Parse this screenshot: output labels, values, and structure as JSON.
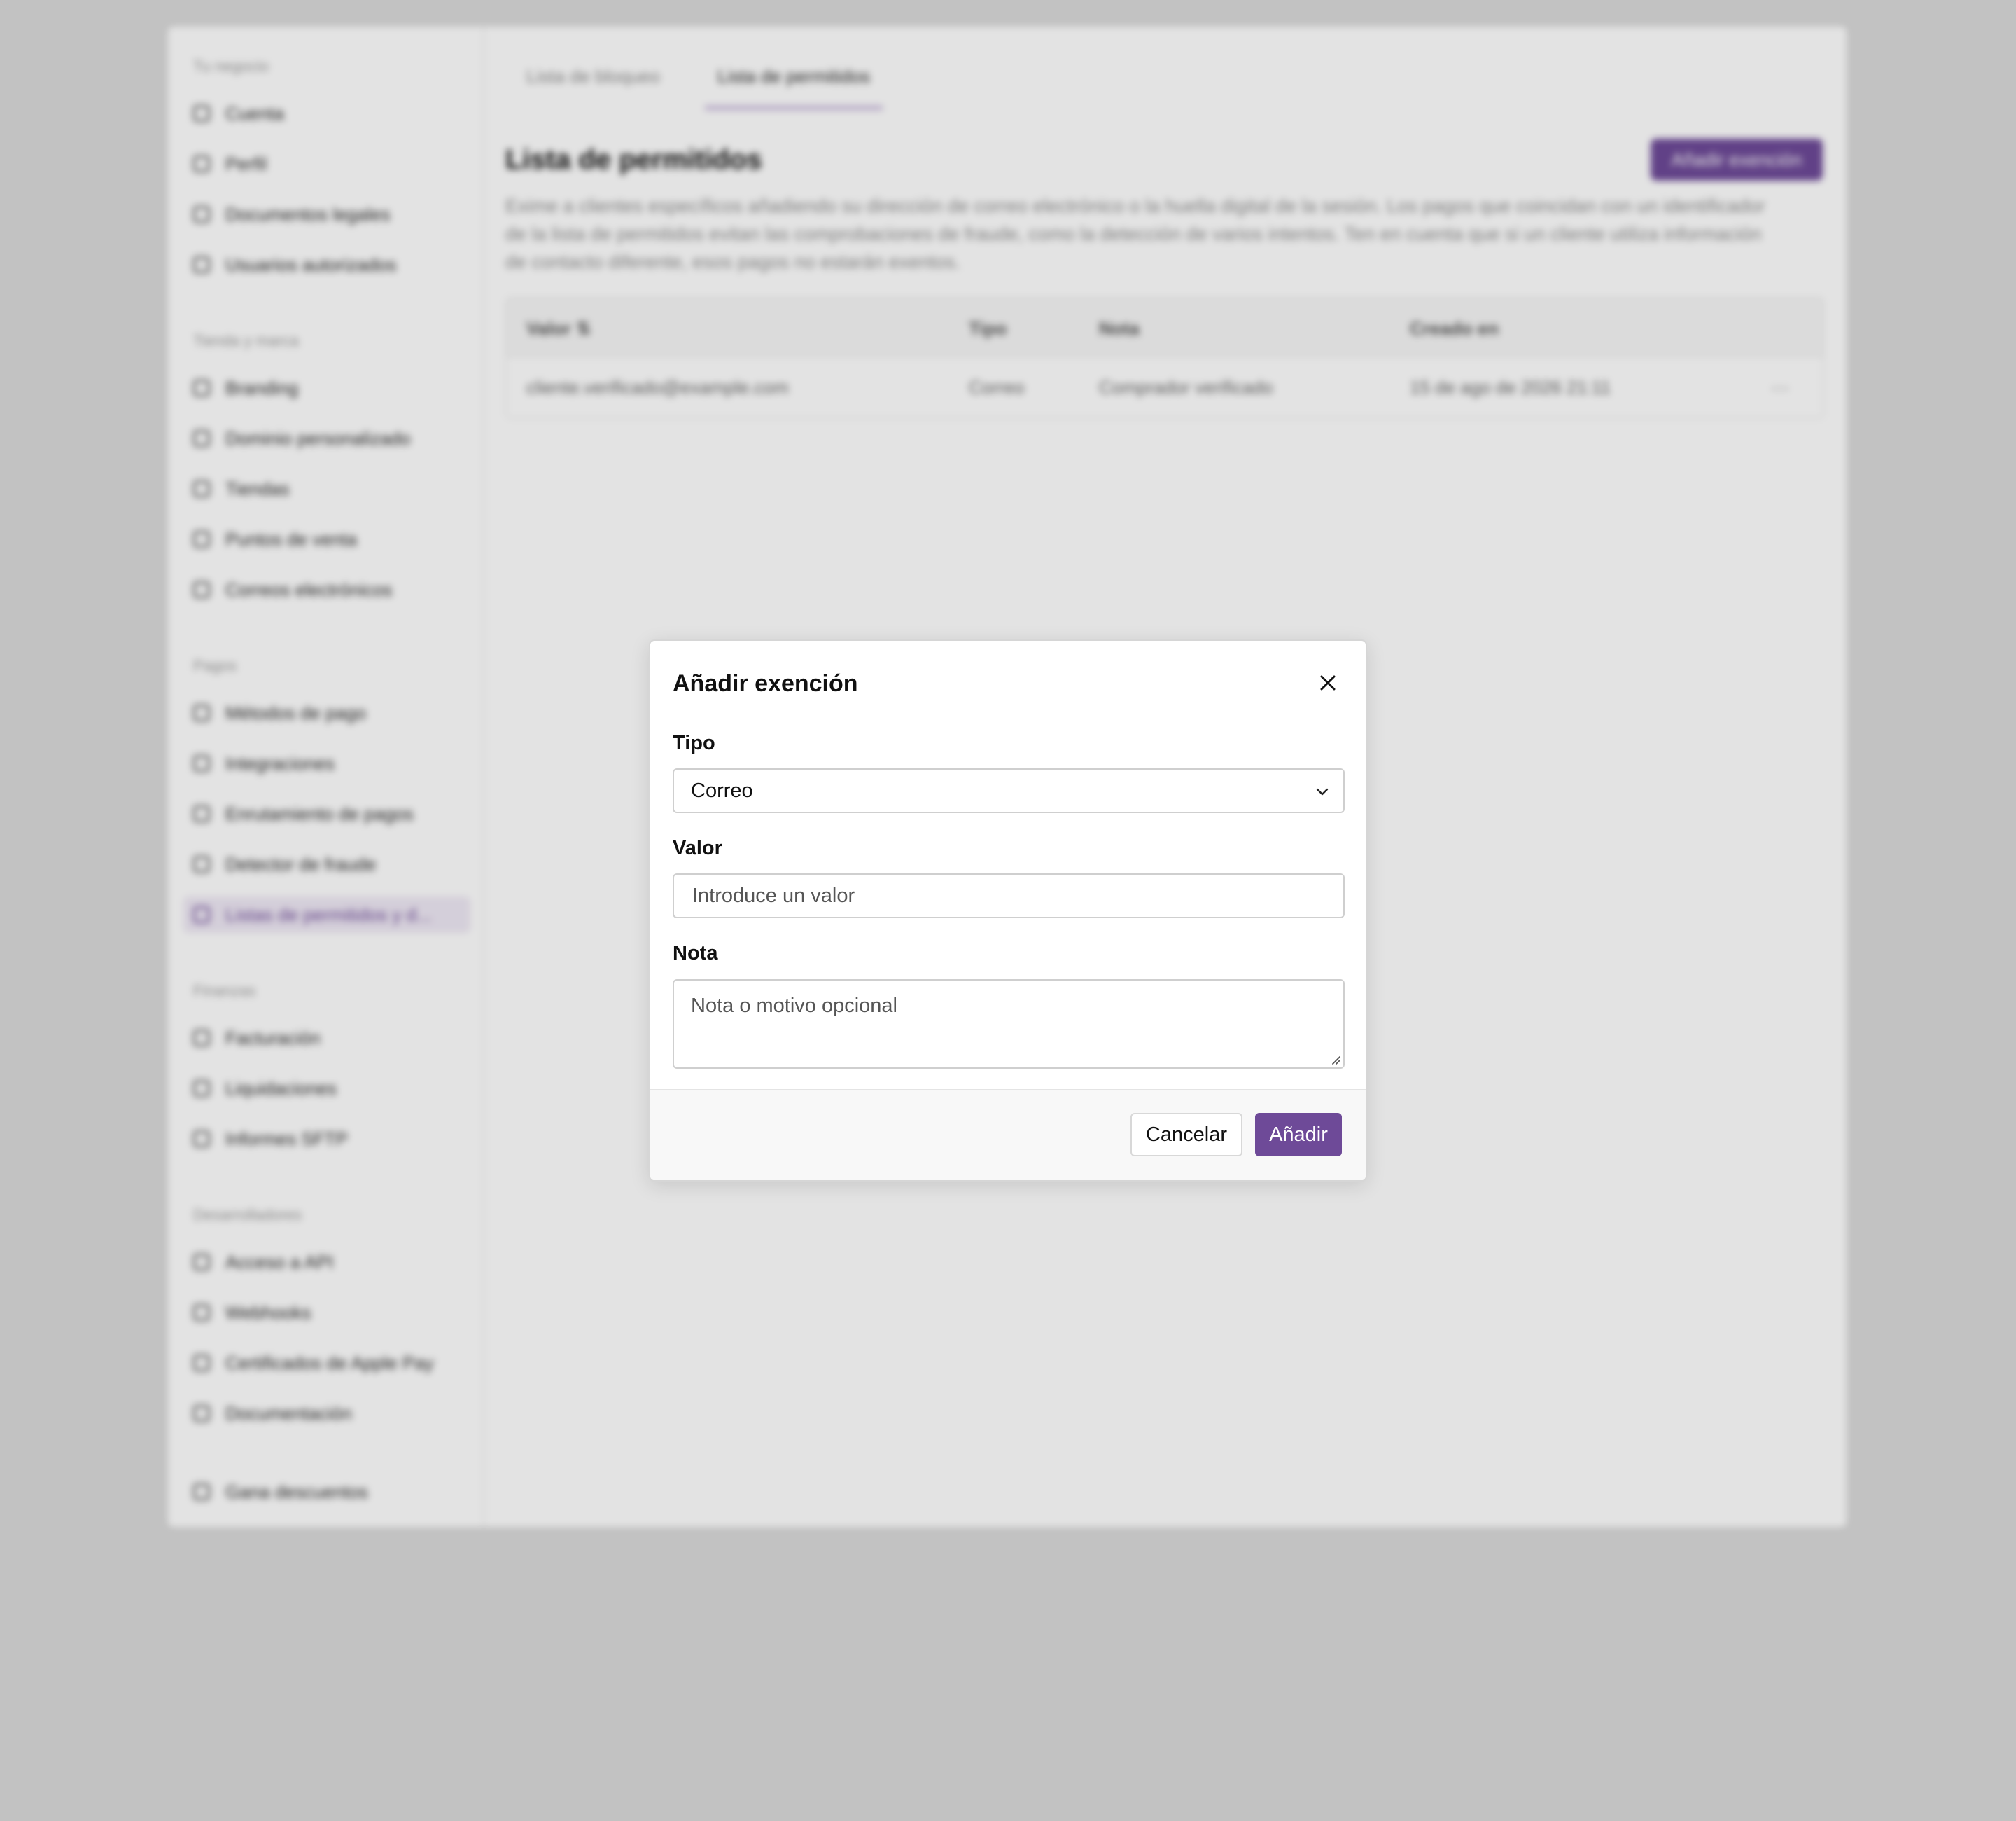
{
  "sidebar": {
    "sections": [
      {
        "title": "Tu negocio",
        "items": [
          {
            "label": "Cuenta",
            "icon": "store-icon"
          },
          {
            "label": "Perfil",
            "icon": "user-icon"
          },
          {
            "label": "Documentos legales",
            "icon": "document-icon"
          },
          {
            "label": "Usuarios autorizados",
            "icon": "users-icon"
          }
        ]
      },
      {
        "title": "Tienda y marca",
        "items": [
          {
            "label": "Branding",
            "icon": "brush-icon"
          },
          {
            "label": "Dominio personalizado",
            "icon": "globe-icon"
          },
          {
            "label": "Tiendas",
            "icon": "shop-icon"
          },
          {
            "label": "Puntos de venta",
            "icon": "device-icon"
          },
          {
            "label": "Correos electrónicos",
            "icon": "mail-icon"
          }
        ]
      },
      {
        "title": "Pagos",
        "items": [
          {
            "label": "Métodos de pago",
            "icon": "card-icon"
          },
          {
            "label": "Integraciones",
            "icon": "grid-icon"
          },
          {
            "label": "Enrutamiento de pagos",
            "icon": "route-icon"
          },
          {
            "label": "Detector de fraude",
            "icon": "shield-icon"
          },
          {
            "label": "Listas de permitidos y d...",
            "icon": "list-icon",
            "active": true
          }
        ]
      },
      {
        "title": "Finanzas",
        "items": [
          {
            "label": "Facturación",
            "icon": "invoice-icon"
          },
          {
            "label": "Liquidaciones",
            "icon": "bank-icon"
          },
          {
            "label": "Informes SFTP",
            "icon": "sync-icon"
          }
        ]
      },
      {
        "title": "Desarrolladores",
        "items": [
          {
            "label": "Acceso a API",
            "icon": "key-icon"
          },
          {
            "label": "Webhooks",
            "icon": "webhook-icon"
          },
          {
            "label": "Certificados de Apple Pay",
            "icon": "certificate-icon"
          },
          {
            "label": "Documentación",
            "icon": "code-icon"
          }
        ]
      }
    ],
    "footer_item": {
      "label": "Gana descuentos",
      "icon": "gift-icon"
    }
  },
  "tabs": [
    {
      "label": "Lista de bloqueo",
      "active": false
    },
    {
      "label": "Lista de permitidos",
      "active": true
    }
  ],
  "page": {
    "title": "Lista de permitidos",
    "add_button": "Añadir exención",
    "description": "Exime a clientes específicos añadiendo su dirección de correo electrónico o la huella digital de la sesión. Los pagos que coincidan con un identificador de la lista de permitidos evitan las comprobaciones de fraude, como la detección de varios intentos. Ten en cuenta que si un cliente utiliza información de contacto diferente, esos pagos no estarán exentos."
  },
  "table": {
    "headers": [
      "Valor ⇅",
      "Tipo",
      "Nota",
      "Creado en"
    ],
    "rows": [
      {
        "valor": "cliente.verificado@example.com",
        "tipo": "Correo",
        "nota": "Comprador verificado",
        "creado": "15 de ago de 2026 21:11",
        "menu": "···"
      }
    ]
  },
  "modal": {
    "title": "Añadir exención",
    "tipo_label": "Tipo",
    "tipo_value": "Correo",
    "valor_label": "Valor",
    "valor_placeholder": "Introduce un valor",
    "nota_label": "Nota",
    "nota_placeholder": "Nota o motivo opcional",
    "cancel": "Cancelar",
    "submit": "Añadir"
  },
  "colors": {
    "accent": "#6e4a98",
    "accent_light": "#efe9f5",
    "overlay": "rgba(0,0,0,0.11)"
  }
}
